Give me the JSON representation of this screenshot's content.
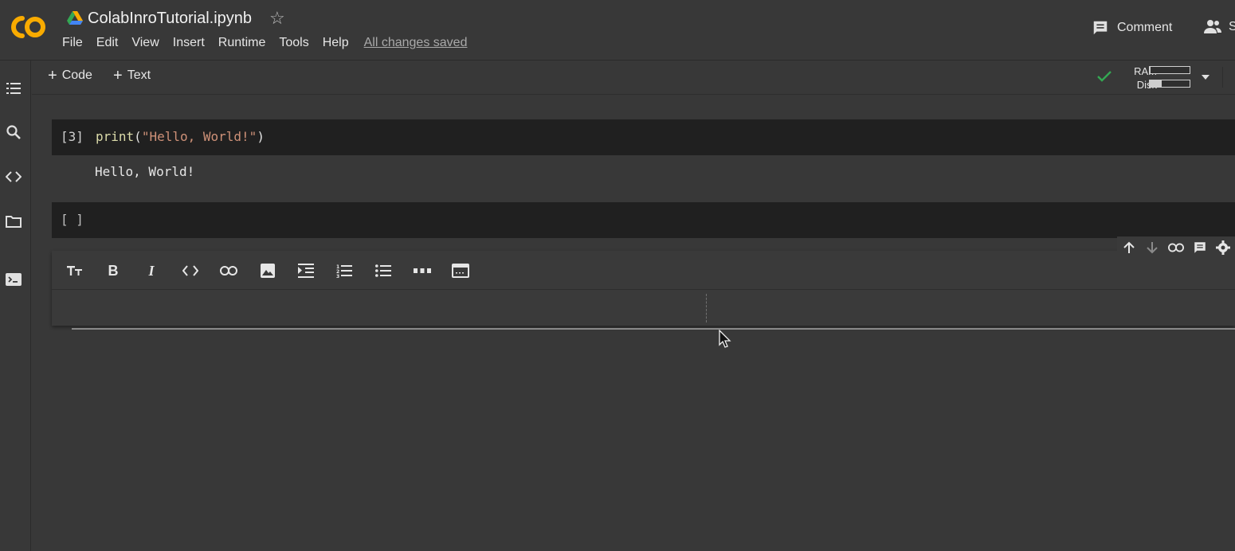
{
  "notebook": {
    "title": "ColabInroTutorial.ipynb",
    "save_status": "All changes saved"
  },
  "menu": [
    "File",
    "Edit",
    "View",
    "Insert",
    "Runtime",
    "Tools",
    "Help"
  ],
  "header_actions": {
    "comment_label": "Comment",
    "share_label": "S"
  },
  "toolbar": {
    "add_code_label": "Code",
    "add_text_label": "Text",
    "ram_label": "RAM",
    "disk_label": "Disk",
    "ram_usage": 0.02,
    "disk_usage": 0.3
  },
  "cells": {
    "code_cell": {
      "exec_count": "[3]",
      "code_fn": "print",
      "code_open": "(",
      "code_string": "\"Hello, World!\"",
      "code_close": ")",
      "output": "Hello, World!"
    },
    "empty_cell": {
      "exec_count": "[ ]"
    }
  },
  "sidebar_icons": [
    "table-of-contents-icon",
    "search-icon",
    "code-snippets-icon",
    "files-icon",
    "terminal-icon"
  ],
  "text_cell_tools": [
    "heading-icon",
    "bold-icon",
    "italic-icon",
    "code-icon",
    "link-icon",
    "image-icon",
    "indent-icon",
    "numbered-list-icon",
    "bulleted-list-icon",
    "horizontal-rule-icon",
    "latex-icon"
  ],
  "colors": {
    "background": "#383838",
    "cell_background": "#202020",
    "accent_orange": "#F9AB00",
    "check_green": "#34A853",
    "string_color": "#ce9178"
  }
}
